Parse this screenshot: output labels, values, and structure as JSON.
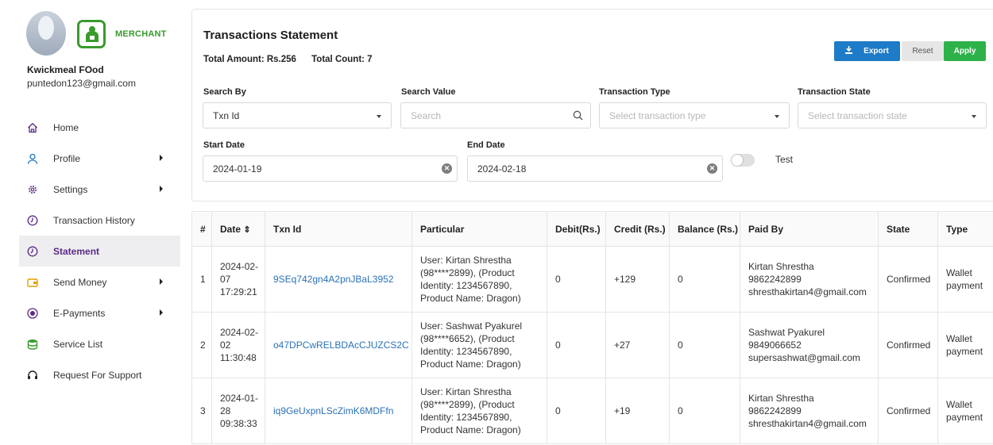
{
  "sidebar": {
    "brand": "MERCHANT",
    "shop_name": "Kwickmeal FOod",
    "email": "puntedon123@gmail.com",
    "items": [
      {
        "label": "Home",
        "icon": "home-icon",
        "has_submenu": false,
        "active": false
      },
      {
        "label": "Profile",
        "icon": "user-icon",
        "has_submenu": true,
        "active": false
      },
      {
        "label": "Settings",
        "icon": "gear-icon",
        "has_submenu": true,
        "active": false
      },
      {
        "label": "Transaction History",
        "icon": "clock-icon",
        "has_submenu": false,
        "active": false
      },
      {
        "label": "Statement",
        "icon": "clock-icon",
        "has_submenu": false,
        "active": true
      },
      {
        "label": "Send Money",
        "icon": "wallet-icon",
        "has_submenu": true,
        "active": false
      },
      {
        "label": "E-Payments",
        "icon": "epay-icon",
        "has_submenu": true,
        "active": false
      },
      {
        "label": "Service List",
        "icon": "database-icon",
        "has_submenu": false,
        "active": false
      },
      {
        "label": "Request For Support",
        "icon": "headset-icon",
        "has_submenu": false,
        "active": false
      }
    ]
  },
  "header": {
    "title": "Transactions Statement",
    "total_amount": "Total Amount: Rs.256",
    "total_count": "Total Count: 7",
    "export_label": "Export",
    "reset_label": "Reset",
    "apply_label": "Apply"
  },
  "filters": {
    "search_by_label": "Search By",
    "search_by_value": "Txn Id",
    "search_value_label": "Search Value",
    "search_placeholder": "Search",
    "txn_type_label": "Transaction Type",
    "txn_type_placeholder": "Select transaction type",
    "txn_state_label": "Transaction State",
    "txn_state_placeholder": "Select transaction state",
    "start_date_label": "Start Date",
    "start_date": "2024-01-19",
    "end_date_label": "End Date",
    "end_date": "2024-02-18",
    "test_label": "Test"
  },
  "table": {
    "columns": [
      "#",
      "Date",
      "Txn Id",
      "Particular",
      "Debit(Rs.)",
      "Credit (Rs.)",
      "Balance (Rs.)",
      "Paid By",
      "State",
      "Type"
    ],
    "sort_glyph": "⇕",
    "rows": [
      {
        "num": "1",
        "date": [
          "2024-02-",
          "07",
          "17:29:21"
        ],
        "txn_id": "9SEq742gn4A2pnJBaL3952",
        "particular": [
          "User: Kirtan Shrestha",
          "(98****2899), (Product",
          "Identity: 1234567890,",
          "Product Name: Dragon)"
        ],
        "debit": "0",
        "credit": "+129",
        "balance": "0",
        "paid_by": [
          "Kirtan Shrestha",
          "9862242899",
          "shresthakirtan4@gmail.com"
        ],
        "state": "Confirmed",
        "type": [
          "Wallet",
          "payment"
        ]
      },
      {
        "num": "2",
        "date": [
          "2024-02-",
          "02",
          "11:30:48"
        ],
        "txn_id": "o47DPCwRELBDAcCJUZCS2C",
        "particular": [
          "User: Sashwat Pyakurel",
          "(98****6652), (Product",
          "Identity: 1234567890,",
          "Product Name: Dragon)"
        ],
        "debit": "0",
        "credit": "+27",
        "balance": "0",
        "paid_by": [
          "Sashwat Pyakurel",
          "9849066652",
          "supersashwat@gmail.com"
        ],
        "state": "Confirmed",
        "type": [
          "Wallet",
          "payment"
        ]
      },
      {
        "num": "3",
        "date": [
          "2024-01-",
          "28",
          "09:38:33"
        ],
        "txn_id": "iq9GeUxpnLScZimK6MDFfn",
        "particular": [
          "User: Kirtan Shrestha",
          "(98****2899), (Product",
          "Identity: 1234567890,",
          "Product Name: Dragon)"
        ],
        "debit": "0",
        "credit": "+19",
        "balance": "0",
        "paid_by": [
          "Kirtan Shrestha",
          "9862242899",
          "shresthakirtan4@gmail.com"
        ],
        "state": "Confirmed",
        "type": [
          "Wallet",
          "payment"
        ]
      }
    ]
  },
  "colors": {
    "brand_green": "#3a9a2e",
    "active_nav": "#5b2a86",
    "export_blue": "#1e7bc7",
    "apply_green": "#2db24a",
    "link_blue": "#2a72b8"
  }
}
